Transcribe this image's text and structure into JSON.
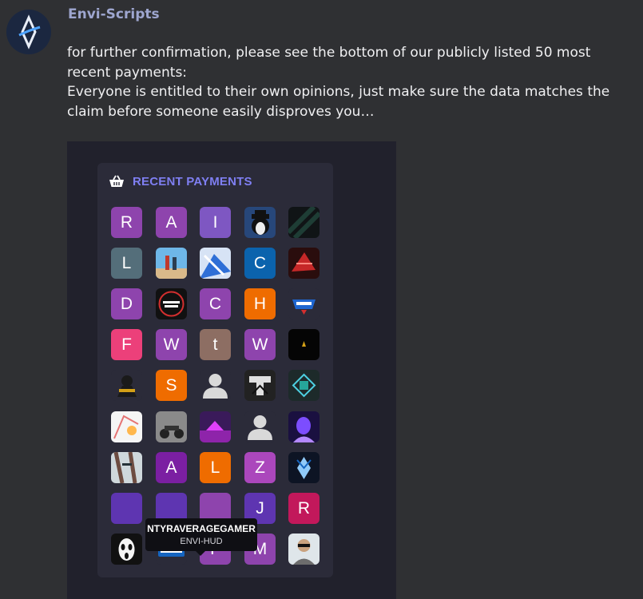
{
  "author": {
    "name": "Envi-Scripts"
  },
  "message": {
    "line1": "for further confirmation, please see the bottom of our publicly listed 50 most recent payments:",
    "line2": "Everyone is entitled to their own opinions, just make sure the data matches the claim before someone easily disproves you…"
  },
  "panel": {
    "title": "RECENT PAYMENTS",
    "icon": "basket-icon"
  },
  "tooltip": {
    "name": "NTYRAVERAGEGAMER",
    "product": "ENVI-HUD"
  },
  "colors": {
    "accent": "#7f7ff2",
    "background": "#2f3033",
    "embed_bg": "#21212c",
    "panel_bg": "#2b2b39"
  },
  "payments": [
    {
      "letter": "R",
      "color": "#8e44ad"
    },
    {
      "letter": "A",
      "color": "#8e44ad"
    },
    {
      "letter": "I",
      "color": "#7e57c2"
    },
    {
      "image": "mafia-penguin-avatar"
    },
    {
      "image": "dark-green-stripes-avatar"
    },
    {
      "letter": "L",
      "color": "#546e7a"
    },
    {
      "image": "beach-photo-avatar"
    },
    {
      "image": "anime-blue-avatar"
    },
    {
      "letter": "C",
      "color": "#0b63ad"
    },
    {
      "image": "red-abstract-avatar"
    },
    {
      "letter": "D",
      "color": "#8e44ad"
    },
    {
      "image": "nightshift-studio-logo"
    },
    {
      "letter": "C",
      "color": "#8e44ad"
    },
    {
      "letter": "H",
      "color": "#ef6c00"
    },
    {
      "image": "england-logo"
    },
    {
      "letter": "F",
      "color": "#ec407a"
    },
    {
      "letter": "W",
      "color": "#8e44ad"
    },
    {
      "letter": "t",
      "color": "#8d6e63"
    },
    {
      "letter": "W",
      "color": "#8e44ad"
    },
    {
      "image": "black-triangle-logo"
    },
    {
      "image": "gold-character-logo"
    },
    {
      "letter": "S",
      "color": "#ef6c00"
    },
    {
      "image": "default-user-avatar"
    },
    {
      "image": "trill-logo"
    },
    {
      "image": "code-grid-logo"
    },
    {
      "image": "anime-sketch-avatar"
    },
    {
      "image": "motorcycle-photo-avatar"
    },
    {
      "image": "purple-scene-avatar"
    },
    {
      "image": "default-user-avatar"
    },
    {
      "image": "purple-girl-avatar"
    },
    {
      "image": "anime-dark-avatar"
    },
    {
      "letter": "A",
      "color": "#7b1fa2"
    },
    {
      "letter": "L",
      "color": "#ef6c00"
    },
    {
      "letter": "Z",
      "color": "#ab47bc"
    },
    {
      "image": "blue-wolf-logo"
    },
    {
      "image": "hidden-avatar"
    },
    {
      "image": "hidden-avatar"
    },
    {
      "letter": "",
      "color": "#8e44ad"
    },
    {
      "letter": "J",
      "color": "#5e35b1"
    },
    {
      "letter": "R",
      "color": "#c2185b"
    },
    {
      "image": "ghostface-avatar"
    },
    {
      "image": "average-gamer-logo"
    },
    {
      "letter": "F",
      "color": "#8e44ad"
    },
    {
      "letter": "M",
      "color": "#8e44ad"
    },
    {
      "image": "man-sunglasses-photo"
    }
  ]
}
